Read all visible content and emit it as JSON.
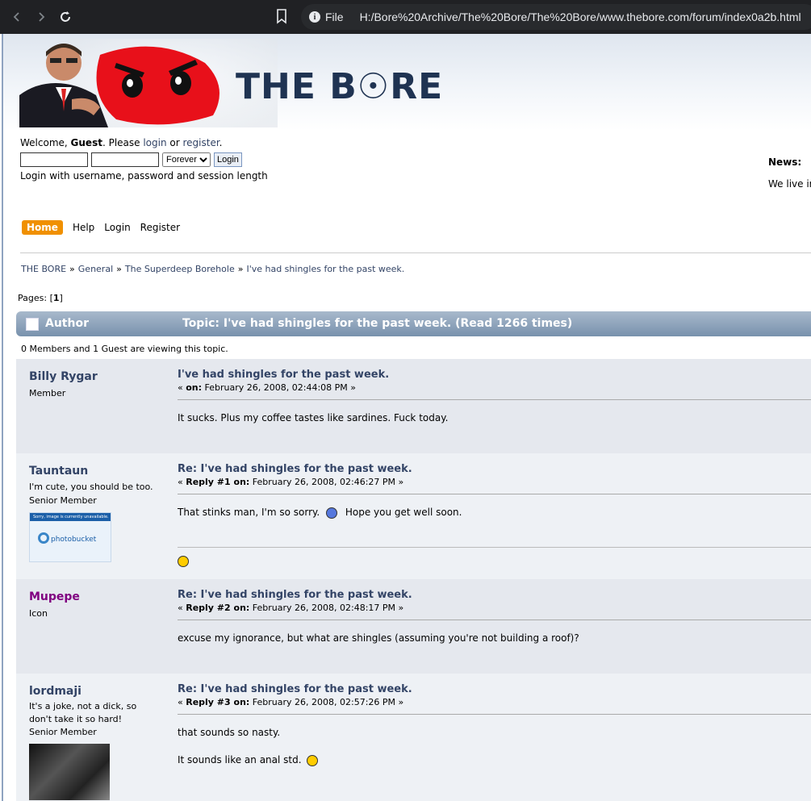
{
  "browser": {
    "file_label": "File",
    "url": "H:/Bore%20Archive/The%20Bore/The%20Bore/www.thebore.com/forum/index0a2b.html"
  },
  "header": {
    "logo_text": "THE B☉RE"
  },
  "welcome": {
    "prefix": "Welcome, ",
    "guest": "Guest",
    "mid": ". Please ",
    "login_link": "login",
    "or": " or ",
    "register_link": "register",
    "suffix": "."
  },
  "login_form": {
    "session_selected": "Forever",
    "login_button": "Login",
    "help_text": "Login with username, password and session length"
  },
  "news": {
    "title": "News:",
    "text": "We live ir"
  },
  "menu": {
    "home": "Home",
    "help": "Help",
    "login": "Login",
    "register": "Register"
  },
  "breadcrumb": {
    "items": [
      "THE BORE",
      "General",
      "The Superdeep Borehole",
      "I've had shingles for the past week."
    ],
    "sep": "»"
  },
  "pages": {
    "label": "Pages: [",
    "current": "1",
    "end": "]"
  },
  "topic_bar": {
    "author": "Author",
    "title": "Topic: I've had shingles for the past week.  (Read 1266 times)"
  },
  "viewing": "0 Members and 1 Guest are viewing this topic.",
  "posts": [
    {
      "name": "Billy Rygar",
      "title_line": "",
      "rank": "Member",
      "subject": "I've had shingles for the past week.",
      "meta_prefix": "« ",
      "meta_bold": "on:",
      "meta_date": " February 26, 2008, 02:44:08 PM »",
      "body": "It sucks.  Plus my coffee tastes like sardines.  Fuck today."
    },
    {
      "name": "Tauntaun",
      "title_line": "I'm cute, you should be too.",
      "rank": "Senior Member",
      "subject": "Re: I've had shingles for the past week.",
      "meta_prefix": "« ",
      "meta_bold": "Reply #1 on:",
      "meta_date": " February 26, 2008, 02:46:27 PM »",
      "body": "That stinks man, I'm so sorry.",
      "body_after": "Hope you get well soon.",
      "avatar_bar": "Sorry, image is currently unavailable.",
      "avatar_brand": "photobucket"
    },
    {
      "name": "Mupepe",
      "title_line": "",
      "rank": "Icon",
      "subject": "Re: I've had shingles for the past week.",
      "meta_prefix": "« ",
      "meta_bold": "Reply #2 on:",
      "meta_date": " February 26, 2008, 02:48:17 PM »",
      "body": "excuse my ignorance, but what are shingles (assuming you're not building a roof)?"
    },
    {
      "name": "lordmaji",
      "title_line": "It's a joke, not a dick, so don't take it so hard!",
      "rank": "Senior Member",
      "subject": "Re: I've had shingles for the past week.",
      "meta_prefix": "« ",
      "meta_bold": "Reply #3 on:",
      "meta_date": " February 26, 2008, 02:57:26 PM »",
      "body": "that sounds so nasty.",
      "body2": "It sounds like an anal std."
    }
  ]
}
